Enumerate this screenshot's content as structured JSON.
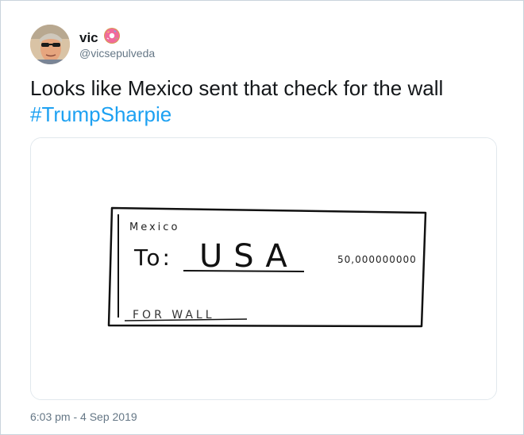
{
  "tweet": {
    "display_name": "vic",
    "name_emoji_icon": "donut-emoji-icon",
    "handle": "@vicsepulveda",
    "text_main": "Looks like Mexico sent that check for the wall ",
    "hashtag": "#TrumpSharpie",
    "timestamp": "6:03 pm - 4 Sep 2019"
  },
  "check_drawing": {
    "payer": "Mexico",
    "to_prefix": "To:",
    "payee": "USA",
    "amount": "50,000000000",
    "memo": "FOR WALL"
  },
  "colors": {
    "hashtag": "#1da1f2",
    "muted": "#657786",
    "border": "#c9d3dc"
  }
}
